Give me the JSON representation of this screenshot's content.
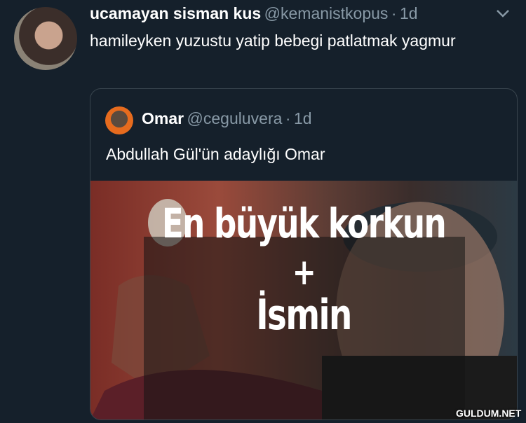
{
  "tweet": {
    "display_name": "ucamayan sisman kus",
    "handle": "@kemanistkopus",
    "separator": "·",
    "time": "1d",
    "text": "hamileyken yuzustu yatip bebegi patlatmak yagmur"
  },
  "quoted_tweet": {
    "display_name": "Omar",
    "handle": "@ceguluvera",
    "separator": "·",
    "time": "1d",
    "text": "Abdullah Gül'ün adaylığı Omar",
    "media_caption": {
      "line1": "En büyük korkun",
      "line2": "+",
      "line3": "İsmin"
    }
  },
  "watermark": "GULDUM.NET",
  "icons": {
    "menu": "chevron-down-icon"
  },
  "colors": {
    "background": "#15202b",
    "secondary_text": "#8899a6",
    "border": "#38444d"
  }
}
